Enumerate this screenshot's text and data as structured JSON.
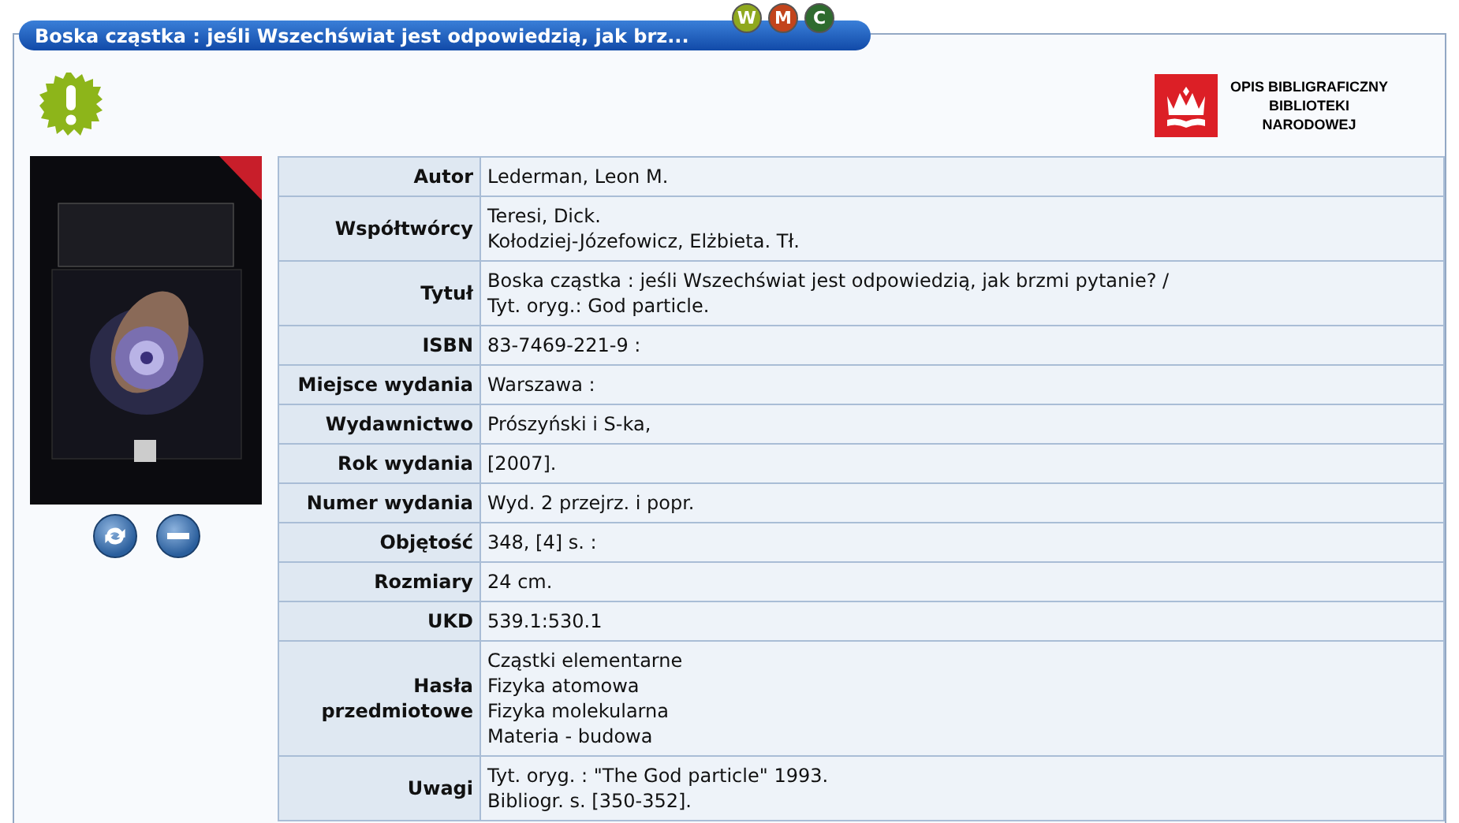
{
  "panel": {
    "title": "Boska cząstka : jeśli Wszechświat jest odpowiedzią, jak brz...",
    "badges": [
      {
        "label": "W",
        "color": "#8fa81e"
      },
      {
        "label": "M",
        "color": "#c2441c"
      },
      {
        "label": "C",
        "color": "#2e6b2e"
      }
    ]
  },
  "logo": {
    "lines": [
      "OPIS BIBLIGRAFICZNY",
      "BIBLIOTEKI",
      "NARODOWEJ"
    ]
  },
  "record": [
    {
      "label": "Autor",
      "lines": [
        "Lederman, Leon M."
      ]
    },
    {
      "label": "Współtwórcy",
      "lines": [
        "Teresi, Dick.",
        "Kołodziej-Józefowicz, Elżbieta. Tł."
      ]
    },
    {
      "label": "Tytuł",
      "lines": [
        "Boska cząstka : jeśli Wszechświat jest odpowiedzią, jak brzmi pytanie? /",
        "Tyt. oryg.: God particle."
      ]
    },
    {
      "label": "ISBN",
      "lines": [
        "83-7469-221-9 :"
      ]
    },
    {
      "label": "Miejsce wydania",
      "lines": [
        "Warszawa :"
      ]
    },
    {
      "label": "Wydawnictwo",
      "lines": [
        "Prószyński i S-ka,"
      ]
    },
    {
      "label": "Rok wydania",
      "lines": [
        "[2007]."
      ]
    },
    {
      "label": "Numer wydania",
      "lines": [
        "Wyd. 2 przejrz. i popr."
      ]
    },
    {
      "label": "Objętość",
      "lines": [
        "348, [4] s. :"
      ]
    },
    {
      "label": "Rozmiary",
      "lines": [
        "24 cm."
      ]
    },
    {
      "label": "UKD",
      "lines": [
        "539.1:530.1"
      ]
    },
    {
      "label": "Hasła przedmiotowe",
      "lines": [
        "Cząstki elementarne",
        "Fizyka atomowa",
        "Fizyka molekularna",
        "Materia - budowa"
      ]
    },
    {
      "label": "Uwagi",
      "lines": [
        "Tyt. oryg. : \"The God particle\" 1993.",
        "Bibliogr. s. [350-352]."
      ]
    }
  ]
}
